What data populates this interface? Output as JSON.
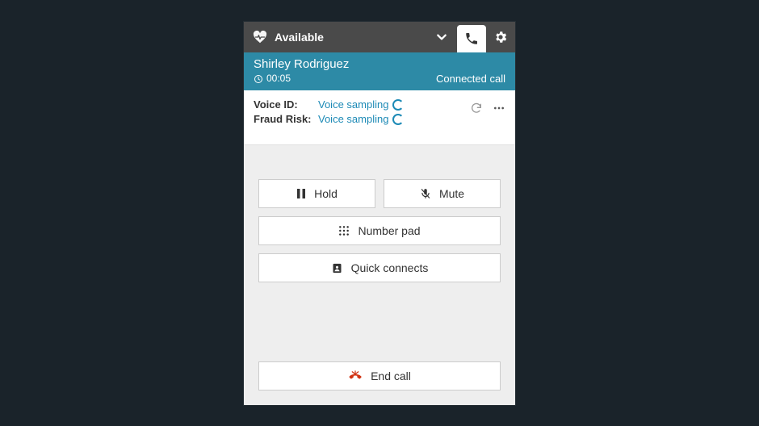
{
  "topbar": {
    "status_label": "Available"
  },
  "caller": {
    "name": "Shirley Rodriguez",
    "timer": "00:05",
    "status": "Connected call"
  },
  "voice": {
    "voice_id_label": "Voice ID:",
    "voice_id_value": "Voice sampling",
    "fraud_label": "Fraud Risk:",
    "fraud_value": "Voice sampling"
  },
  "controls": {
    "hold": "Hold",
    "mute": "Mute",
    "number_pad": "Number pad",
    "quick_connects": "Quick connects",
    "end_call": "End call"
  }
}
